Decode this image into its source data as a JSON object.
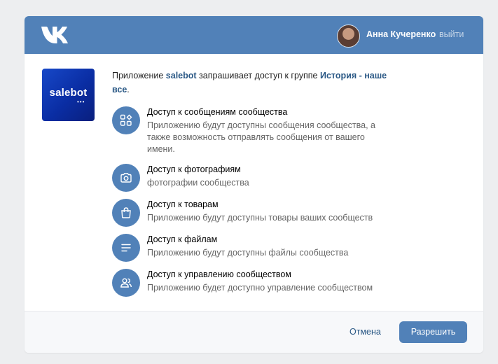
{
  "header": {
    "user_name": "Анна Кучеренко",
    "logout_label": "выйти",
    "logo_icon": "vk-logo-icon"
  },
  "app": {
    "logo_text": "salebot",
    "logo_dots": "•••"
  },
  "intro": {
    "prefix": "Приложение ",
    "app_name": "salebot",
    "middle": " запрашивает доступ к группе ",
    "group_name": "История - наше все",
    "suffix": "."
  },
  "permissions": [
    {
      "title": "Доступ к сообщениям сообщества",
      "description": "Приложению будут доступны сообщения сообщества, а также возможность отправлять сообщения от вашего имени.",
      "icon": "messages-icon"
    },
    {
      "title": "Доступ к фотографиям",
      "description": "фотографии сообщества",
      "icon": "camera-icon"
    },
    {
      "title": "Доступ к товарам",
      "description": "Приложению будут доступны товары ваших сообществ",
      "icon": "shopping-bag-icon"
    },
    {
      "title": "Доступ к файлам",
      "description": "Приложению будут доступны файлы сообщества",
      "icon": "document-lines-icon"
    },
    {
      "title": "Доступ к управлению сообществом",
      "description": "Приложению будет доступно управление сообществом",
      "icon": "users-icon"
    }
  ],
  "footer": {
    "cancel_label": "Отмена",
    "allow_label": "Разрешить"
  },
  "colors": {
    "accent": "#5181b8",
    "link": "#2a5885",
    "background": "#edeef0"
  }
}
